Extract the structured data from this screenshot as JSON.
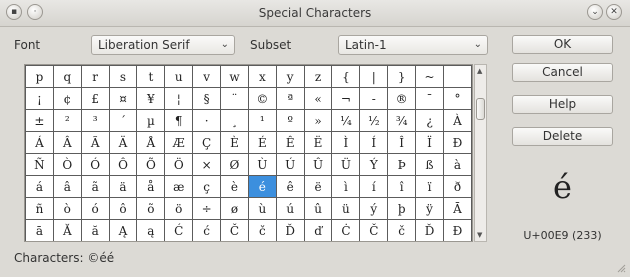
{
  "window": {
    "title": "Special Characters"
  },
  "font": {
    "label": "Font",
    "value": "Liberation Serif"
  },
  "subset": {
    "label": "Subset",
    "value": "Latin-1"
  },
  "grid": {
    "rows": [
      [
        "p",
        "q",
        "r",
        "s",
        "t",
        "u",
        "v",
        "w",
        "x",
        "y",
        "z",
        "{",
        "|",
        "}",
        "~",
        ""
      ],
      [
        "¡",
        "¢",
        "£",
        "¤",
        "¥",
        "¦",
        "§",
        "¨",
        "©",
        "ª",
        "«",
        "¬",
        "-",
        "®",
        "¯",
        "°"
      ],
      [
        "±",
        "²",
        "³",
        "´",
        "µ",
        "¶",
        "·",
        "¸",
        "¹",
        "º",
        "»",
        "¼",
        "½",
        "¾",
        "¿",
        "À"
      ],
      [
        "Á",
        "Â",
        "Ã",
        "Ä",
        "Å",
        "Æ",
        "Ç",
        "È",
        "É",
        "Ê",
        "Ë",
        "Ì",
        "Í",
        "Î",
        "Ï",
        "Ð"
      ],
      [
        "Ñ",
        "Ò",
        "Ó",
        "Ô",
        "Õ",
        "Ö",
        "×",
        "Ø",
        "Ù",
        "Ú",
        "Û",
        "Ü",
        "Ý",
        "Þ",
        "ß",
        "à"
      ],
      [
        "á",
        "â",
        "ã",
        "ä",
        "å",
        "æ",
        "ç",
        "è",
        "é",
        "ê",
        "ë",
        "ì",
        "í",
        "î",
        "ï",
        "ð"
      ],
      [
        "ñ",
        "ò",
        "ó",
        "ô",
        "õ",
        "ö",
        "÷",
        "ø",
        "ù",
        "ú",
        "û",
        "ü",
        "ý",
        "þ",
        "ÿ",
        "Ā"
      ],
      [
        "ā",
        "Ă",
        "ă",
        "Ą",
        "ą",
        "Ć",
        "ć",
        "Č",
        "č",
        "Ď",
        "ď",
        "Ċ",
        "Č",
        "č",
        "Ď",
        "Đ"
      ]
    ],
    "selected": {
      "row": 5,
      "col": 8
    }
  },
  "buttons": {
    "ok": "OK",
    "cancel": "Cancel",
    "help": "Help",
    "delete": "Delete"
  },
  "preview": {
    "char": "é",
    "code": "U+00E9 (233)"
  },
  "characters": {
    "label": "Characters:",
    "value": "©éé"
  },
  "icons": {
    "close": "close-icon",
    "minimize": "minimize-icon",
    "menu": "window-menu-icon",
    "combo_arrow": "chevron-down-icon"
  }
}
